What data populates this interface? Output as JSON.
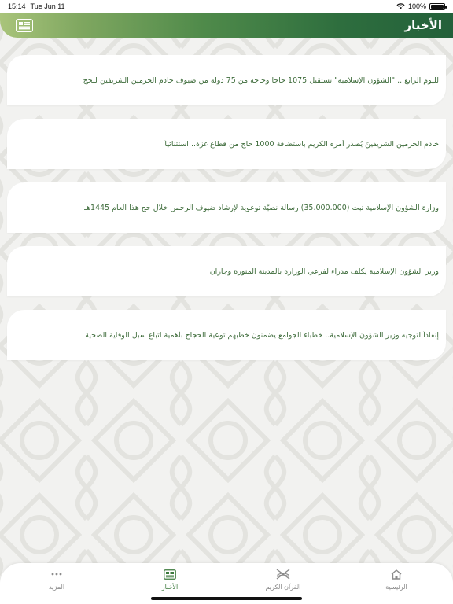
{
  "status_bar": {
    "time": "15:14",
    "date": "Tue Jun 11",
    "battery": "100%"
  },
  "header": {
    "title": "الأخبار",
    "menu_icon": "news-list-icon"
  },
  "news": [
    "لليوم الرابع .. \"الشؤون الإسلامية\" تستقبل 1075 حاجا وحاجة من 75 دولة من ضيوف خادم الحرمين الشريفين للحج",
    "خادم الحرمين الشريفينَ يُصدر أمره الكريم باستضافة 1000 حاجٍ من قطاع غزة.. استثنائياً",
    "وزارة الشؤون الإسلامية تبث (35.000.000) رسالة نصيّة توعوية لإرشاد ضيوف الرحمن خلال حج هذا العام 1445هـ",
    "وزير الشؤون الإسلامية يكلف مدراء لفرعي الوزارة بالمدينة المنورة وجازان",
    "إنفاذاً لتوجيه وزير الشؤون الإسلامية.. خطباء الجوامع يضمنون خطبهم توعية الحجاج بأهمية اتباع سبل الوقاية الصحية"
  ],
  "tabs": [
    {
      "label": "المزيد",
      "icon": "more-dots-icon"
    },
    {
      "label": "الأخبار",
      "icon": "news-icon",
      "active": true
    },
    {
      "label": "القرآن الكريم",
      "icon": "quran-icon"
    },
    {
      "label": "الرئيسية",
      "icon": "home-icon"
    }
  ],
  "colors": {
    "header_dark": "#23603a",
    "header_light": "#a9c47b",
    "news_text": "#3d6b3a",
    "active_tab": "#3d7a3d"
  }
}
